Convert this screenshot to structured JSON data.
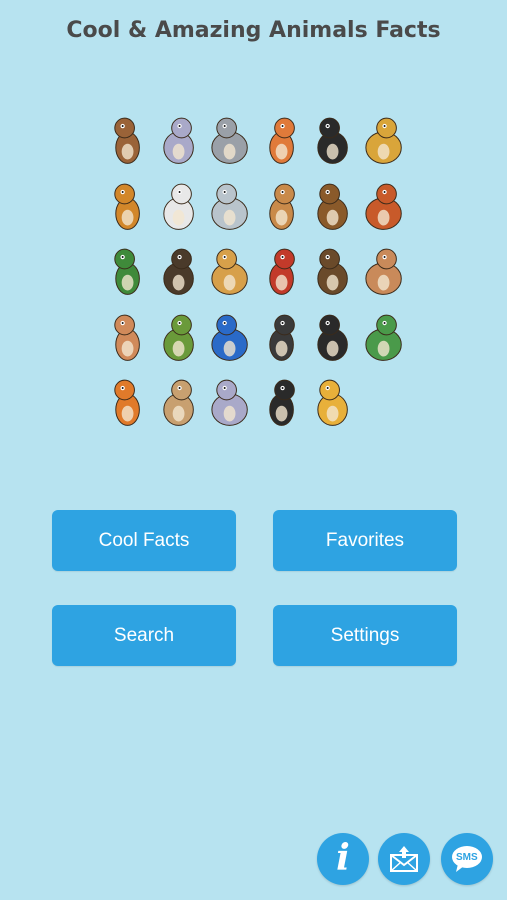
{
  "header": {
    "title": "Cool & Amazing Animals Facts"
  },
  "collage": {
    "icon": "animal-collage-illustration",
    "animals": [
      {
        "name": "owl-flying-icon",
        "color": "#9a6338"
      },
      {
        "name": "elephant-icon",
        "color": "#a9a9c9"
      },
      {
        "name": "owl-icon",
        "color": "#9aa0a8"
      },
      {
        "name": "fox-icon",
        "color": "#e07a3a"
      },
      {
        "name": "toucan-icon",
        "color": "#2a2a2a"
      },
      {
        "name": "giraffe-icon",
        "color": "#d9a53a"
      },
      {
        "name": "lion-icon",
        "color": "#d2872a"
      },
      {
        "name": "pelican-icon",
        "color": "#e8e8e8"
      },
      {
        "name": "goat-icon",
        "color": "#b9c4cc"
      },
      {
        "name": "deer-icon",
        "color": "#c98a4a"
      },
      {
        "name": "snail-icon",
        "color": "#8a5a2a"
      },
      {
        "name": "mandarin-duck-icon",
        "color": "#c85a2a"
      },
      {
        "name": "duck-icon",
        "color": "#3f8a3a"
      },
      {
        "name": "ostrich-icon",
        "color": "#4a3a2a"
      },
      {
        "name": "camel-icon",
        "color": "#d7a04a"
      },
      {
        "name": "snake-icon",
        "color": "#c23a2a"
      },
      {
        "name": "eagle-owl-icon",
        "color": "#6a4a2a"
      },
      {
        "name": "kangaroo-icon",
        "color": "#c98a5a"
      },
      {
        "name": "kangaroo-standing-icon",
        "color": "#d08a5a"
      },
      {
        "name": "turtle-icon",
        "color": "#6a9a3a"
      },
      {
        "name": "parrot-icon",
        "color": "#2a6ac8"
      },
      {
        "name": "bald-eagle-icon",
        "color": "#3a3a3a"
      },
      {
        "name": "skunk-icon",
        "color": "#2a2a2a"
      },
      {
        "name": "crocodile-icon",
        "color": "#4a9a4a"
      },
      {
        "name": "tiger-icon",
        "color": "#e07a2a"
      },
      {
        "name": "dog-icon",
        "color": "#c8a070"
      },
      {
        "name": "baby-elephant-icon",
        "color": "#a9a9c9"
      },
      {
        "name": "toucan-perched-icon",
        "color": "#2a2a2a"
      },
      {
        "name": "cheetah-icon",
        "color": "#e8b03a"
      },
      {
        "name": "empty",
        "color": "#b7e3f0"
      }
    ]
  },
  "buttons": {
    "cool_facts": "Cool Facts",
    "favorites": "Favorites",
    "search": "Search",
    "settings": "Settings"
  },
  "footer": {
    "info_icon": "info-icon",
    "info_glyph": "i",
    "mail_icon": "mail-icon",
    "sms_icon": "sms-icon",
    "sms_label": "SMS"
  },
  "colors": {
    "background": "#b7e3f0",
    "button": "#2ea3e2",
    "title_text": "#4a4a4a"
  }
}
